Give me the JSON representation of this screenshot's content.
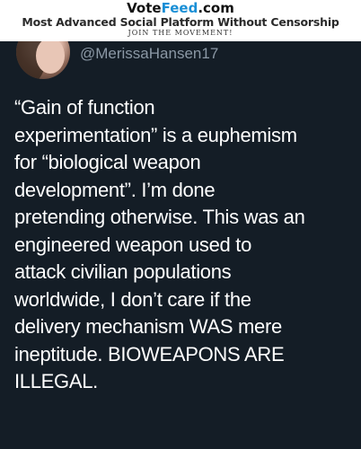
{
  "banner": {
    "brand_prefix": "Vote",
    "brand_highlight": "Feed",
    "brand_suffix": ".com",
    "tagline": "Most Advanced Social Platform Without Censorship",
    "movement": "JOIN THE MOVEMENT!"
  },
  "colors": {
    "background": "#141d26",
    "brand_highlight": "#1a8fd6",
    "handle": "#8b98a5",
    "text": "#ffffff"
  },
  "tweet": {
    "avatar_icon": "profile-photo",
    "handle": "@MerissaHansen17",
    "text": "“Gain of function\nexperimentation” is a euphemism\nfor “biological weapon\ndevelopment”.   I’m done\npretending otherwise. This was an\nengineered weapon used to\nattack civilian populations\nworldwide, I don’t care if the\ndelivery mechanism WAS mere\nineptitude. BIOWEAPONS ARE\nILLEGAL."
  }
}
